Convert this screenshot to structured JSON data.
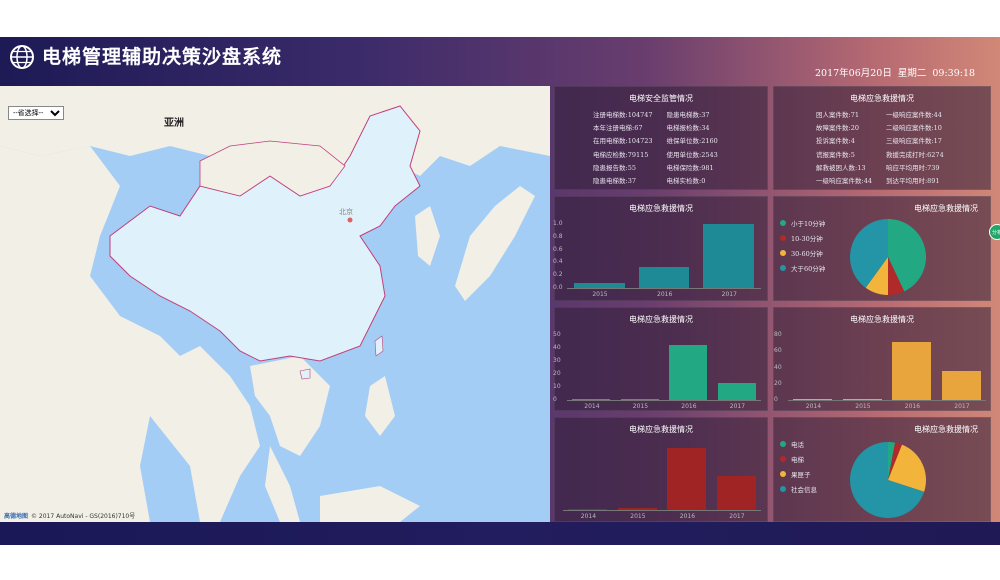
{
  "header": {
    "title": "电梯管理辅助决策沙盘系统",
    "date": "2017年06月20日",
    "weekday": "星期二",
    "time": "09:39:18"
  },
  "map": {
    "province_select": "--省选择--",
    "continent_label": "亚洲",
    "capital_label": "北京",
    "credit_brand": "高德地图",
    "credit_text": "© 2017 AutoNavi - GS(2016)710号"
  },
  "panels": {
    "supervision": {
      "title": "电梯安全监管情况",
      "stats": [
        [
          "注册电梯数:104747",
          "隐患电梯数:37"
        ],
        [
          "本年注册电梯:67",
          "电梯报检数:34"
        ],
        [
          "在用电梯数:104723",
          "维保单位数:2160"
        ],
        [
          "电梯应检数:79115",
          "使用单位数:2543"
        ],
        [
          "隐患报告数:55",
          "电梯保险数:981"
        ],
        [
          "隐患电梯数:37",
          "电梯实检数:0"
        ]
      ]
    },
    "rescue_stats": {
      "title": "电梯应急救援情况",
      "stats": [
        [
          "困人案件数:71",
          "一级响应案件数:44"
        ],
        [
          "故障案件数:20",
          "二级响应案件数:10"
        ],
        [
          "投诉案件数:4",
          "三级响应案件数:17"
        ],
        [
          "谎报案件数:5",
          "救援完成打时:6274"
        ],
        [
          "解救被困人数:13",
          "响应平均用时:739"
        ],
        [
          "一级响应案件数:44",
          "到达平均用时:891"
        ]
      ]
    },
    "side_button": "分析"
  },
  "chart_data": [
    {
      "type": "bar",
      "title": "电梯应急救援情况",
      "categories": [
        "2015",
        "2016",
        "2017"
      ],
      "values": [
        0.08,
        0.33,
        1.0
      ],
      "yticks": [
        "0.0",
        "0.2",
        "0.4",
        "0.6",
        "0.8",
        "1.0"
      ],
      "ylim": [
        0,
        1.0
      ],
      "color": "#1e8a96"
    },
    {
      "type": "pie",
      "title": "电梯应急救援情况",
      "legend": [
        "小于10分钟",
        "10-30分钟",
        "30-60分钟",
        "大于60分钟"
      ],
      "values": [
        43,
        7,
        10,
        40
      ],
      "colors": [
        "#23a884",
        "#b02a2a",
        "#f2b43a",
        "#2395a6"
      ]
    },
    {
      "type": "bar",
      "title": "电梯应急救援情况",
      "categories": [
        "2014",
        "2015",
        "2016",
        "2017"
      ],
      "values": [
        0.5,
        0.5,
        42,
        13
      ],
      "yticks": [
        "0",
        "10",
        "20",
        "30",
        "40",
        "50"
      ],
      "ylim": [
        0,
        50
      ],
      "color": "#23a884"
    },
    {
      "type": "bar",
      "title": "电梯应急救援情况",
      "categories": [
        "2014",
        "2015",
        "2016",
        "2017"
      ],
      "values": [
        0.5,
        1.5,
        71,
        36
      ],
      "yticks": [
        "0",
        "20",
        "40",
        "60",
        "80"
      ],
      "ylim": [
        0,
        80
      ],
      "color": "#e8a53d"
    },
    {
      "type": "bar",
      "title": "电梯应急救援情况",
      "categories": [
        "2014",
        "2015",
        "2016",
        "2017"
      ],
      "values": [
        0.5,
        1.5,
        44,
        24
      ],
      "yticks": [],
      "ylim": [
        0,
        48
      ],
      "color": "#a02424"
    },
    {
      "type": "pie",
      "title": "电梯应急救援情况",
      "legend": [
        "电话",
        "电梯",
        "果匣子",
        "社会信息"
      ],
      "values": [
        3,
        3,
        24,
        70
      ],
      "colors": [
        "#23a884",
        "#b02a2a",
        "#f2b43a",
        "#2395a6"
      ]
    }
  ]
}
